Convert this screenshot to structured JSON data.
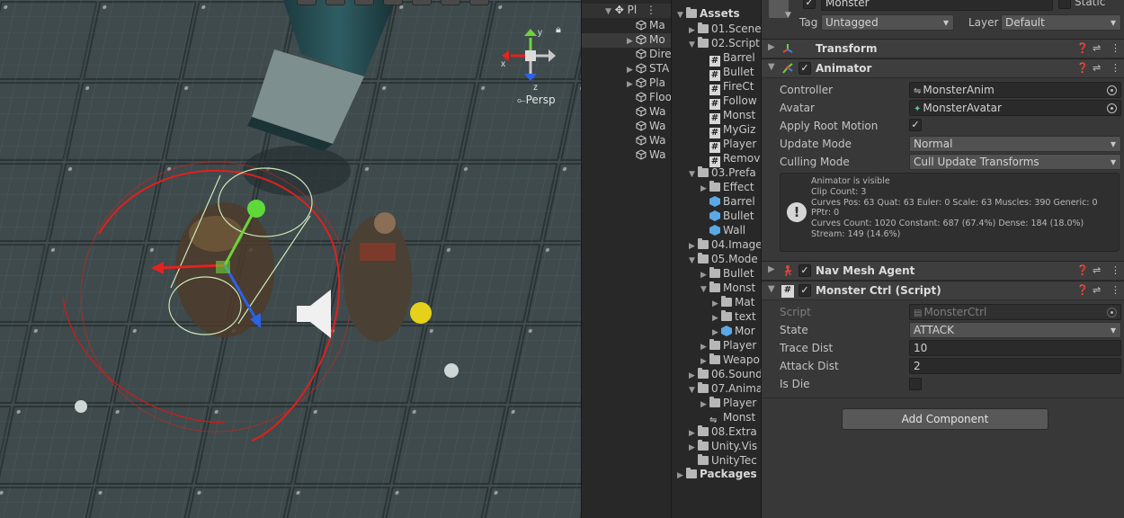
{
  "scene": {
    "persp_label": "Persp",
    "gizmo_axes": {
      "y": "y",
      "x": "x",
      "z": "z"
    }
  },
  "hierarchy": {
    "scene_label": "Pl",
    "items": [
      "Ma",
      "Mo",
      "Dire",
      "STA",
      "Pla",
      "Floo",
      "Wa",
      "Wa",
      "Wa",
      "Wa"
    ]
  },
  "project": {
    "root": "Assets",
    "rows": [
      {
        "label": "01.Scene",
        "type": "folder",
        "indent": 1,
        "arrow": "▶"
      },
      {
        "label": "02.Script",
        "type": "folder",
        "indent": 1,
        "arrow": "▼"
      },
      {
        "label": "Barrel",
        "type": "script",
        "indent": 2,
        "arrow": ""
      },
      {
        "label": "Bullet",
        "type": "script",
        "indent": 2,
        "arrow": ""
      },
      {
        "label": "FireCt",
        "type": "script",
        "indent": 2,
        "arrow": ""
      },
      {
        "label": "Follow",
        "type": "script",
        "indent": 2,
        "arrow": ""
      },
      {
        "label": "Monst",
        "type": "script",
        "indent": 2,
        "arrow": ""
      },
      {
        "label": "MyGiz",
        "type": "script",
        "indent": 2,
        "arrow": ""
      },
      {
        "label": "Player",
        "type": "script",
        "indent": 2,
        "arrow": ""
      },
      {
        "label": "Remov",
        "type": "script",
        "indent": 2,
        "arrow": ""
      },
      {
        "label": "03.Prefa",
        "type": "folder",
        "indent": 1,
        "arrow": "▼"
      },
      {
        "label": "Effect",
        "type": "folder",
        "indent": 2,
        "arrow": "▶"
      },
      {
        "label": "Barrel",
        "type": "prefab",
        "indent": 2,
        "arrow": ""
      },
      {
        "label": "Bullet",
        "type": "prefab",
        "indent": 2,
        "arrow": ""
      },
      {
        "label": "Wall",
        "type": "prefab",
        "indent": 2,
        "arrow": ""
      },
      {
        "label": "04.Image",
        "type": "folder",
        "indent": 1,
        "arrow": "▶"
      },
      {
        "label": "05.Mode",
        "type": "folder",
        "indent": 1,
        "arrow": "▼"
      },
      {
        "label": "Bullet",
        "type": "folder",
        "indent": 2,
        "arrow": "▶"
      },
      {
        "label": "Monst",
        "type": "folder",
        "indent": 2,
        "arrow": "▼"
      },
      {
        "label": "Mat",
        "type": "folder",
        "indent": 3,
        "arrow": "▶"
      },
      {
        "label": "text",
        "type": "folder",
        "indent": 3,
        "arrow": "▶"
      },
      {
        "label": "Mor",
        "type": "prefab",
        "indent": 3,
        "arrow": "▶"
      },
      {
        "label": "Player",
        "type": "folder",
        "indent": 2,
        "arrow": "▶"
      },
      {
        "label": "Weapo",
        "type": "folder",
        "indent": 2,
        "arrow": "▶"
      },
      {
        "label": "06.Sound",
        "type": "folder",
        "indent": 1,
        "arrow": "▶"
      },
      {
        "label": "07.Anima",
        "type": "folder",
        "indent": 1,
        "arrow": "▼"
      },
      {
        "label": "Player",
        "type": "folder",
        "indent": 2,
        "arrow": "▶"
      },
      {
        "label": "Monst",
        "type": "anim",
        "indent": 2,
        "arrow": ""
      },
      {
        "label": "08.Extra",
        "type": "folder",
        "indent": 1,
        "arrow": "▶"
      },
      {
        "label": "Unity.Vis",
        "type": "folder",
        "indent": 1,
        "arrow": "▶"
      },
      {
        "label": "UnityTec",
        "type": "folder",
        "indent": 1,
        "arrow": ""
      }
    ],
    "packages": "Packages"
  },
  "inspector": {
    "object_name": "Monster",
    "static_label": "Static",
    "tag_label": "Tag",
    "tag_value": "Untagged",
    "layer_label": "Layer",
    "layer_value": "Default",
    "transform_title": "Transform",
    "animator": {
      "title": "Animator",
      "controller_label": "Controller",
      "controller_value": "MonsterAnim",
      "avatar_label": "Avatar",
      "avatar_value": "MonsterAvatar",
      "apply_root_motion_label": "Apply Root Motion",
      "apply_root_motion": true,
      "update_mode_label": "Update Mode",
      "update_mode_value": "Normal",
      "culling_mode_label": "Culling Mode",
      "culling_mode_value": "Cull Update Transforms",
      "info": "Animator is visible\nClip Count: 3\nCurves Pos: 63 Quat: 63 Euler: 0 Scale: 63 Muscles: 390 Generic: 0 PPtr: 0\nCurves Count: 1020 Constant: 687 (67.4%) Dense: 184 (18.0%) Stream: 149 (14.6%)"
    },
    "navmesh_title": "Nav Mesh Agent",
    "monster_ctrl": {
      "title": "Monster Ctrl (Script)",
      "script_label": "Script",
      "script_value": "MonsterCtrl",
      "state_label": "State",
      "state_value": "ATTACK",
      "trace_label": "Trace Dist",
      "trace_value": "10",
      "attack_label": "Attack Dist",
      "attack_value": "2",
      "isdie_label": "Is Die"
    },
    "add_component": "Add Component"
  }
}
